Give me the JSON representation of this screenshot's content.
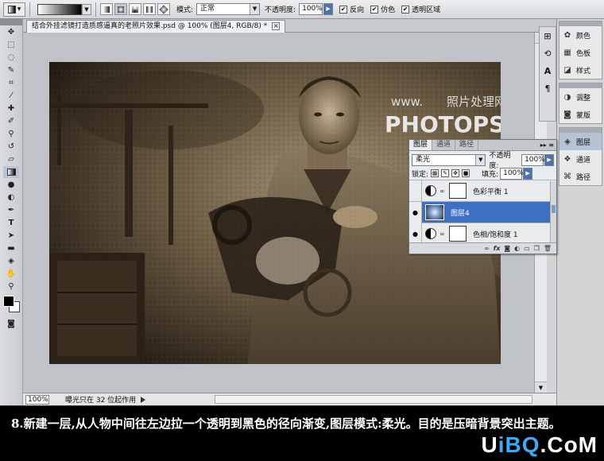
{
  "options_bar": {
    "mode_label": "模式:",
    "mode_value": "正常",
    "opacity_label": "不透明度:",
    "opacity_value": "100%",
    "reverse_label": "反向",
    "dither_label": "仿色",
    "transparency_label": "透明区域"
  },
  "document": {
    "tab_title": "结合外挂滤镜打造质感逼真的老照片效果.psd @ 100% (图层4, RGB/8) *",
    "watermark_line1": "www.",
    "watermark_line2": "照片处理网",
    "watermark_line3": "PHOTOPS.COM"
  },
  "status": {
    "zoom": "100%",
    "info": "曝光只在 32 位起作用"
  },
  "dock": {
    "group1": [
      "颜色",
      "色板",
      "样式"
    ],
    "group2": [
      "调整",
      "蒙版"
    ],
    "group3": [
      "图层",
      "通道",
      "路径"
    ]
  },
  "layers_panel": {
    "tabs": [
      "图层",
      "通道",
      "路径"
    ],
    "blend_mode": "柔光",
    "opacity_label": "不透明度:",
    "opacity_value": "100%",
    "lock_label": "锁定:",
    "fill_label": "填充:",
    "fill_value": "100%",
    "layers": [
      {
        "name": "色彩平衡 1",
        "visible": false,
        "selected": false
      },
      {
        "name": "图层4",
        "visible": true,
        "selected": true
      },
      {
        "name": "色相/饱和度 1",
        "visible": true,
        "selected": false
      }
    ],
    "footer_icons": [
      "link-icon",
      "fx-icon",
      "mask-icon",
      "adjustment-icon",
      "group-icon",
      "new-layer-icon",
      "trash-icon"
    ]
  },
  "caption": {
    "text": "8.新建一层,从人物中间往左边拉一个透明到黑色的径向渐变,图层模式:柔光。目的是压暗背景突出主题。",
    "brand_prefix": "U",
    "brand_mid": "iBQ",
    "brand_suffix": ".CoM"
  }
}
